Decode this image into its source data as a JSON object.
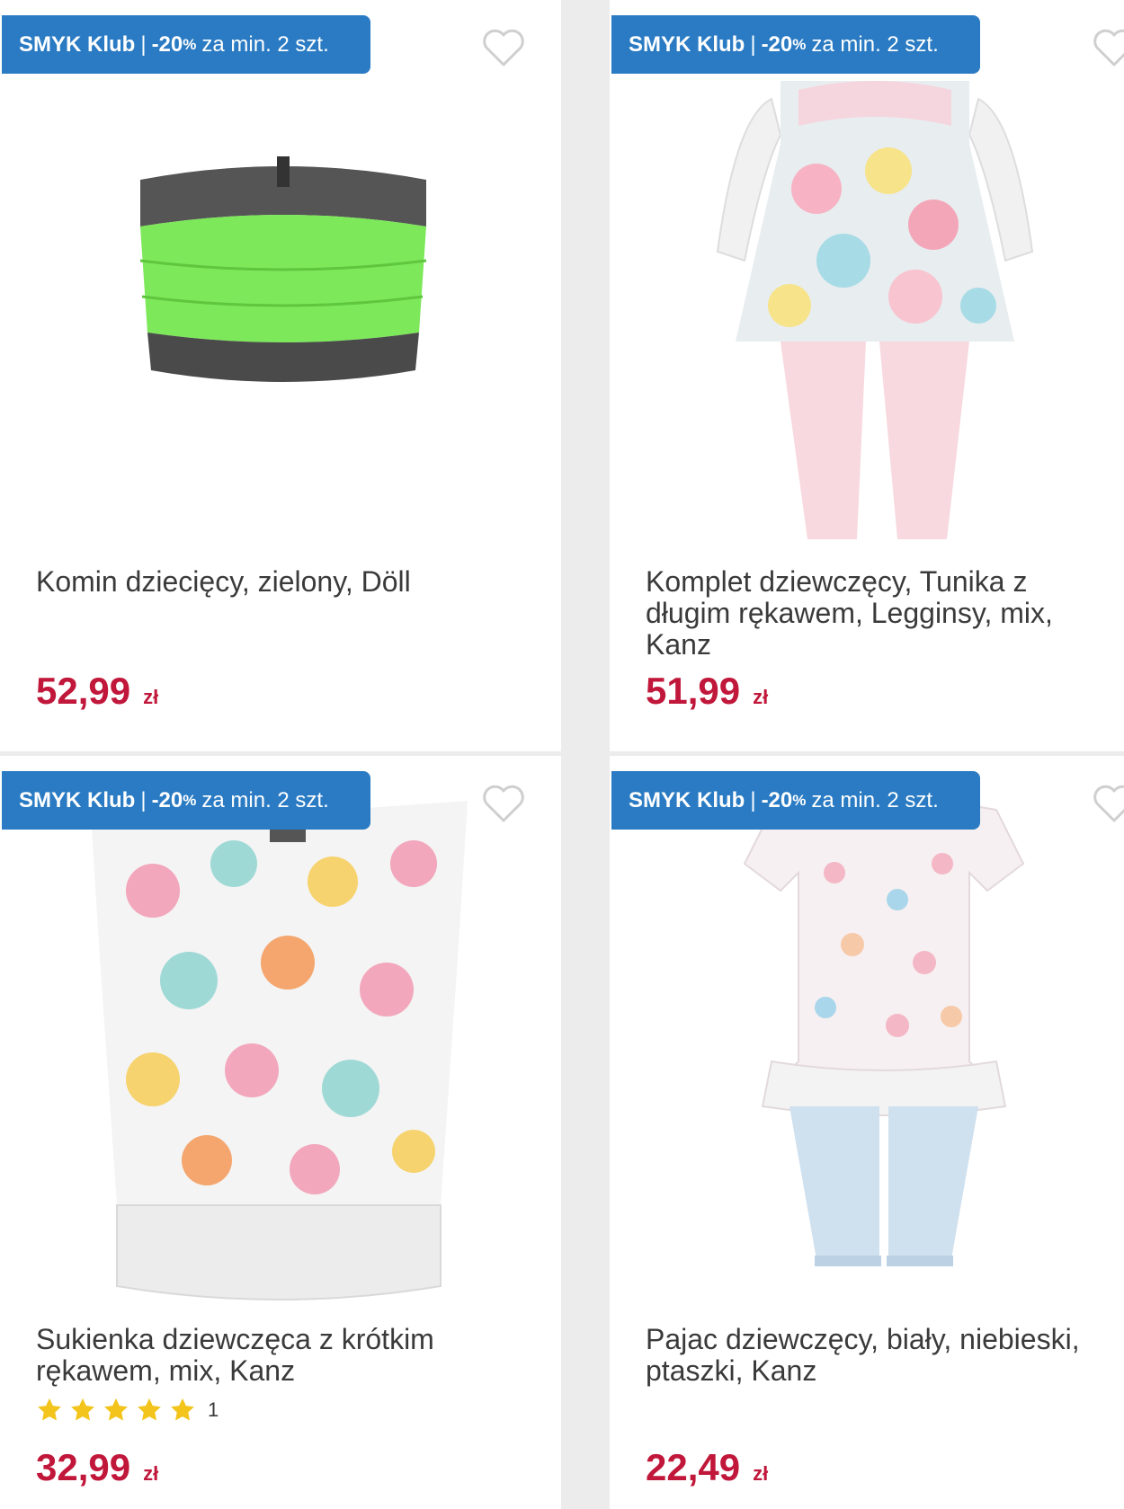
{
  "promo": {
    "brand": "SMYK Klub",
    "separator": "|",
    "discount": "-20",
    "percent": "%",
    "condition": "za min. 2 szt."
  },
  "colors": {
    "badge_bg": "#2a7bc3",
    "price": "#c0173a",
    "star": "#f2c41c"
  },
  "products": [
    {
      "title": "Komin dziecięcy, zielony, Döll",
      "price": "52,99",
      "currency": "zł",
      "image": "green-knit-snood"
    },
    {
      "title": "Komplet dziewczęcy, Tunika z długim rękawem, Legginsy, mix, Kanz",
      "price": "51,99",
      "currency": "zł",
      "image": "floral-tunic-pink-leggings"
    },
    {
      "title": "Sukienka dziewczęca z krótkim rękawem, mix, Kanz",
      "rating_stars": 5,
      "rating_count": "1",
      "price": "32,99",
      "currency": "zł",
      "image": "floral-dress-lace-hem"
    },
    {
      "title": "Pajac dziewczęcy, biały, niebieski, ptaszki, Kanz",
      "price": "22,49",
      "currency": "zł",
      "image": "white-blue-romper"
    }
  ]
}
